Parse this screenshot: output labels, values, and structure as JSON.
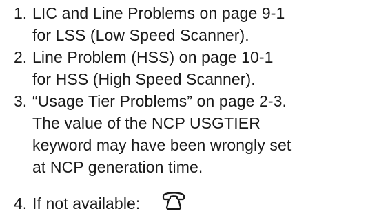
{
  "items": [
    {
      "number": "1.",
      "lines": [
        "LIC and Line Problems on page  9-1",
        "for LSS (Low Speed Scanner)."
      ]
    },
    {
      "number": "2.",
      "lines": [
        "Line Problem (HSS) on page  10-1",
        "for HSS (High Speed Scanner)."
      ]
    },
    {
      "number": "3.",
      "lines": [
        "“Usage Tier Problems” on page  2-3.",
        "The value of the NCP USGTIER",
        "keyword may have been wrongly set",
        "at NCP generation time."
      ]
    },
    {
      "number": "4.",
      "lines": [
        "If not available:"
      ],
      "icon": "telephone-icon"
    }
  ]
}
